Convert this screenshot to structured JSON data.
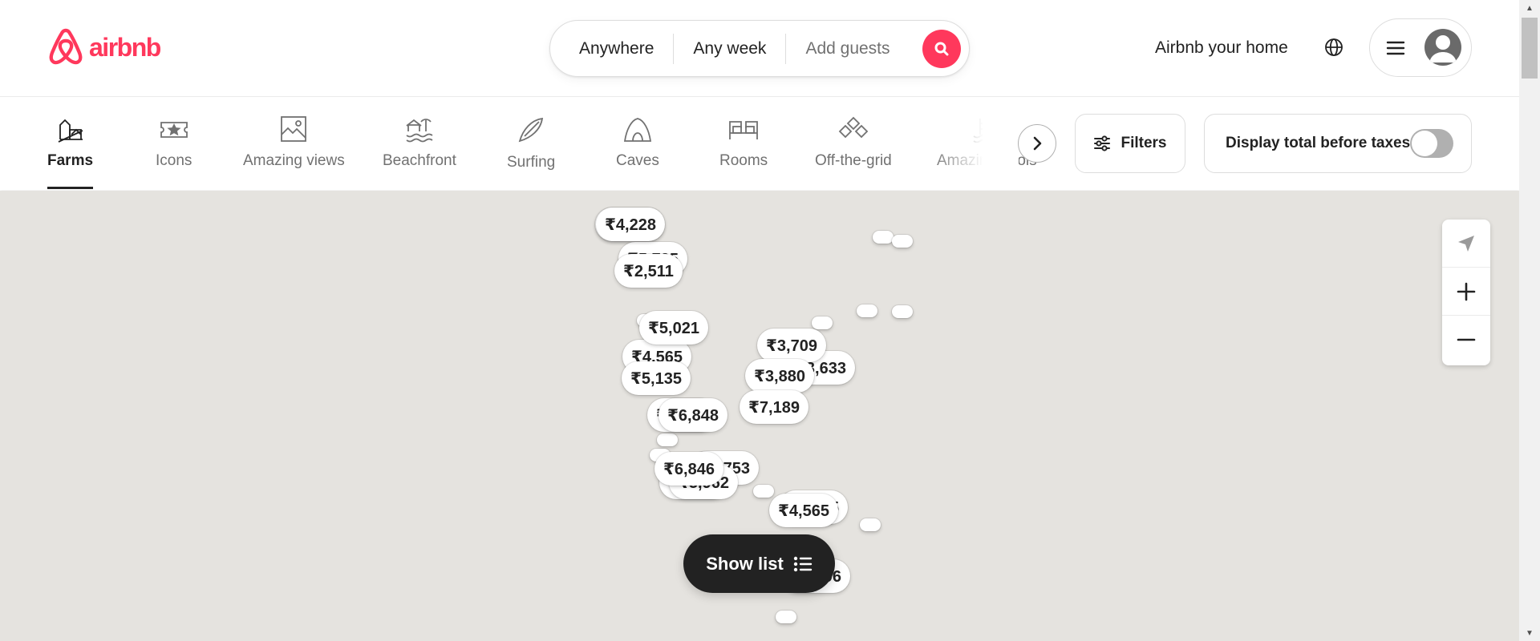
{
  "header": {
    "logo_text": "airbnb",
    "search": {
      "where": "Anywhere",
      "when": "Any week",
      "who": "Add guests"
    },
    "host_link": "Airbnb your home",
    "brand_color": "#ff385c"
  },
  "categories": [
    {
      "label": "Farms",
      "icon": "farm-icon",
      "active": true
    },
    {
      "label": "Icons",
      "icon": "icons-ticket-icon",
      "active": false
    },
    {
      "label": "Amazing views",
      "icon": "amazing-views-icon",
      "active": false
    },
    {
      "label": "Beachfront",
      "icon": "beachfront-icon",
      "active": false
    },
    {
      "label": "Surfing",
      "icon": "surfboard-icon",
      "active": false
    },
    {
      "label": "Caves",
      "icon": "cave-icon",
      "active": false
    },
    {
      "label": "Rooms",
      "icon": "bed-icon",
      "active": false
    },
    {
      "label": "Off-the-grid",
      "icon": "off-grid-icon",
      "active": false
    },
    {
      "label": "Amazing pools",
      "icon": "pool-icon",
      "active": false
    }
  ],
  "filters": {
    "label": "Filters",
    "tax_label": "Display total before taxes",
    "tax_toggle_on": false
  },
  "map": {
    "prices": [
      "₹4,228",
      "₹5,795",
      "₹2,511",
      "₹5,021",
      "₹4,565",
      "₹5,135",
      "₹3,709",
      "₹3,633",
      "₹3,880",
      "₹7,189",
      "₹6,848",
      "₹6,753",
      "₹6,846",
      "₹3,962",
      "₹4,565",
      "₹4,565",
      "₹4,596"
    ],
    "show_list_label": "Show list"
  }
}
